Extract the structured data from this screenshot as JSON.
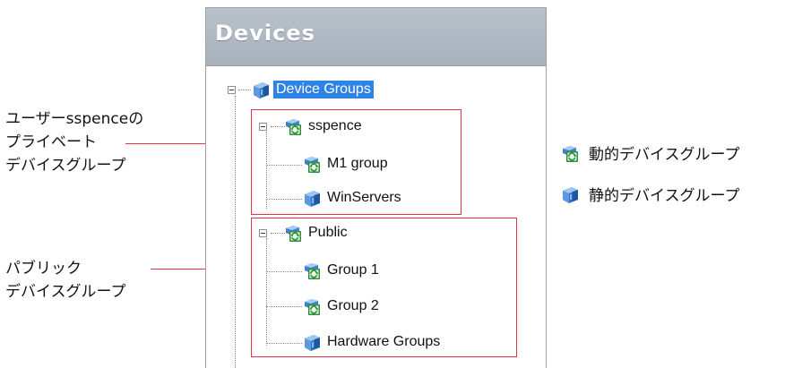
{
  "panel": {
    "title": "Devices"
  },
  "tree": {
    "root": {
      "label": "Device Groups",
      "icon": "static-group-icon",
      "selected": true
    },
    "sspence": {
      "label": "sspence",
      "icon": "dynamic-group-icon",
      "children": [
        {
          "label": "M1 group",
          "icon": "dynamic-group-icon"
        },
        {
          "label": "WinServers",
          "icon": "static-group-icon"
        }
      ]
    },
    "public": {
      "label": "Public",
      "icon": "dynamic-group-icon",
      "children": [
        {
          "label": "Group 1",
          "icon": "dynamic-group-icon"
        },
        {
          "label": "Group 2",
          "icon": "dynamic-group-icon"
        },
        {
          "label": "Hardware Groups",
          "icon": "static-group-icon"
        }
      ]
    }
  },
  "annotations": {
    "private": {
      "line1": "ユーザーsspenceの",
      "line2": "プライベート",
      "line3": "デバイスグループ"
    },
    "public": {
      "line1": "パブリック",
      "line2": "デバイスグループ"
    }
  },
  "legend": {
    "dynamic": {
      "label": "動的デバイスグループ",
      "icon": "dynamic-group-icon"
    },
    "static": {
      "label": "静的デバイスグループ",
      "icon": "static-group-icon"
    }
  },
  "colors": {
    "highlight_border": "#e8334a",
    "selection": "#2f83e6",
    "header": "#b0b8c2"
  }
}
